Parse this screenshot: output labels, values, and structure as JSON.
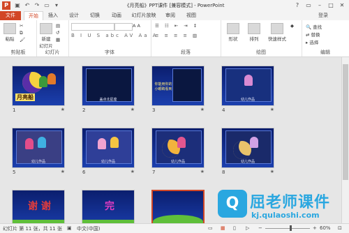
{
  "window": {
    "title": "《月亮船》PPT课件 [兼容模式] - PowerPoint",
    "app_icon_letter": "P",
    "quick_access": [
      "save-icon",
      "undo-icon",
      "redo-icon",
      "present-icon",
      "customize-icon"
    ],
    "controls": [
      "?",
      "restore",
      "minimize",
      "maximize",
      "close"
    ],
    "login": "登录"
  },
  "tabs": [
    "文件",
    "开始",
    "插入",
    "设计",
    "切换",
    "动画",
    "幻灯片放映",
    "审阅",
    "视图"
  ],
  "active_tab": "开始",
  "ribbon": {
    "clipboard": {
      "label": "剪贴板",
      "paste": "粘贴"
    },
    "slides": {
      "label": "幻灯片",
      "new_slide": "新建\n幻灯片"
    },
    "font": {
      "label": "字体",
      "buttons": "B I U S abc AV Aa A"
    },
    "paragraph": {
      "label": "段落"
    },
    "drawing": {
      "label": "绘图",
      "shapes": "形状",
      "arrange": "排列",
      "quick_styles": "快速样式"
    },
    "editing": {
      "label": "编辑",
      "find": "查找",
      "replace": "替换",
      "select": "选择"
    }
  },
  "slides": [
    {
      "num": "1",
      "caption": "月亮船",
      "theme": "purple"
    },
    {
      "num": "2",
      "caption": "盖点北星座",
      "theme": "blue"
    },
    {
      "num": "3",
      "caption": "你能用你的\n小眼睛看到",
      "theme": "blue"
    },
    {
      "num": "4",
      "caption": "幼儿作品",
      "theme": "blue"
    },
    {
      "num": "5",
      "caption": "幼儿作品",
      "theme": "blue"
    },
    {
      "num": "6",
      "caption": "幼儿作品",
      "theme": "blue"
    },
    {
      "num": "7",
      "caption": "幼儿作品",
      "theme": "blue"
    },
    {
      "num": "8",
      "caption": "幼儿作品",
      "theme": "blue"
    },
    {
      "num": "9",
      "caption": "谢 谢",
      "theme": "light"
    },
    {
      "num": "10",
      "caption": "完",
      "theme": "light"
    },
    {
      "num": "11",
      "caption": "",
      "theme": "green"
    }
  ],
  "status": {
    "slide_info": "幻灯片 第 11 张，共 11 张",
    "language": "中文(中国)",
    "zoom": "60%"
  },
  "watermark": {
    "logo": "Q",
    "text": "屈老师课件",
    "url": "kj.qulaoshi.com"
  }
}
